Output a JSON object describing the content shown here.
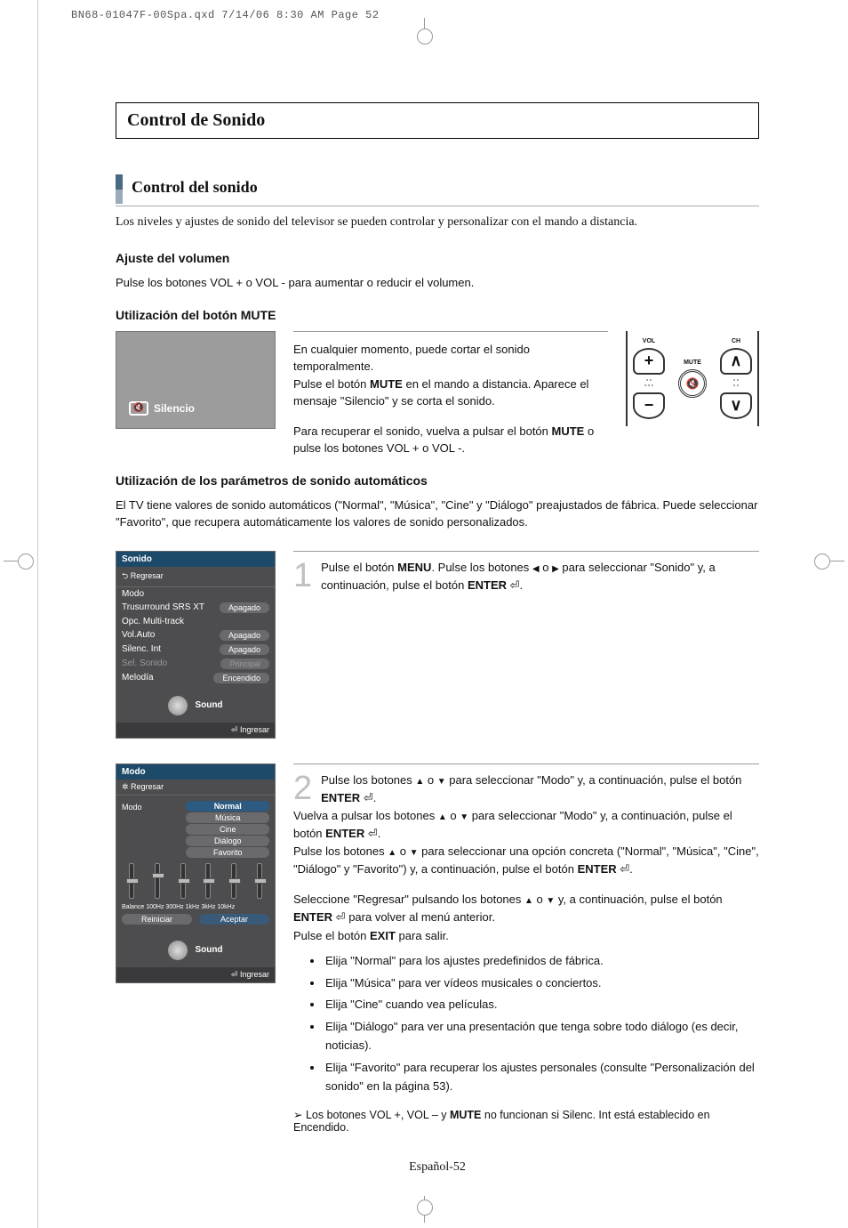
{
  "print_header": "BN68-01047F-00Spa.qxd  7/14/06  8:30 AM  Page 52",
  "title": "Control de Sonido",
  "section": {
    "heading": "Control del sonido",
    "intro": "Los niveles y ajustes de sonido del televisor se pueden controlar y personalizar con el mando a distancia."
  },
  "subs": {
    "vol": {
      "title": "Ajuste del volumen",
      "text": "Pulse los botones VOL + o VOL - para aumentar o reducir el volumen."
    },
    "mute": {
      "title": "Utilización del botón MUTE",
      "badge": "Silencio",
      "p1a": "En cualquier momento, puede cortar el sonido temporalmente.",
      "p1b_pre": "Pulse el botón ",
      "p1b_b": "MUTE",
      "p1b_post": " en el mando a distancia. Aparece el mensaje \"Silencio\" y se corta el sonido.",
      "p2_pre": "Para recuperar el sonido, vuelva a pulsar el botón ",
      "p2_b": "MUTE",
      "p2_post": " o pulse los botones VOL + o VOL -."
    },
    "auto": {
      "title": "Utilización de los parámetros de sonido automáticos",
      "intro": "El TV tiene valores de sonido automáticos (\"Normal\", \"Música\", \"Cine\" y \"Diálogo\" preajustados de fábrica. Puede seleccionar \"Favorito\", que recupera automáticamente los valores de sonido personalizados."
    }
  },
  "remote": {
    "vol": "VOL",
    "ch": "CH",
    "mute": "MUTE"
  },
  "osd1": {
    "title": "Sonido",
    "back": "Regresar",
    "items": [
      {
        "label": "Modo",
        "value": ""
      },
      {
        "label": "Trusurround SRS XT",
        "value": "Apagado"
      },
      {
        "label": "Opc. Multi-track",
        "value": ""
      },
      {
        "label": "Vol.Auto",
        "value": "Apagado"
      },
      {
        "label": "Silenc. Int",
        "value": "Apagado"
      },
      {
        "label": "Sel. Sonido",
        "value": "Principal",
        "disabled": true
      },
      {
        "label": "Melodía",
        "value": "Encendido"
      }
    ],
    "cat": "Sound",
    "enter": "Ingresar"
  },
  "osd2": {
    "title": "Modo",
    "back": "Regresar",
    "left": "Modo",
    "opts": [
      "Normal",
      "Música",
      "Cine",
      "Diálogo",
      "Favorito"
    ],
    "eq": "Balance 100Hz 300Hz 1kHz  3kHz 10kHz",
    "reset": "Reiniciar",
    "accept": "Aceptar",
    "cat": "Sound",
    "enter": "Ingresar"
  },
  "step1": {
    "num": "1",
    "t1": "Pulse el botón ",
    "b1": "MENU",
    "t2": ". Pulse los botones ",
    "t3": " o ",
    "t4": " para seleccionar \"Sonido\" y, a continuación, pulse el botón ",
    "b2": "ENTER",
    "t5": "."
  },
  "step2": {
    "num": "2",
    "l1a": "Pulse los botones ",
    "l1b": " o ",
    "l1c": " para seleccionar \"Modo\" y, a continuación, pulse el botón ",
    "enter": "ENTER",
    "dot": ".",
    "l2a": "Vuelva a pulsar los botones ",
    "l2b": " o ",
    "l2c": " para seleccionar \"Modo\"  y, a continuación, pulse el botón ",
    "l3a": "Pulse los botones ",
    "l3b": " o ",
    "l3c": " para seleccionar una opción concreta (\"Normal\", \"Música\", \"Cine\", \"Diálogo\" y \"Favorito\") y, a continuación, pulse el botón ",
    "l4a": "Seleccione \"Regresar\" pulsando los botones ",
    "l4b": " o ",
    "l4c": " y, a continuación, pulse el botón ",
    "l4d": " para volver al menú anterior.",
    "l5a": "Pulse el botón ",
    "exit": "EXIT",
    "l5b": " para salir.",
    "opts": [
      "Elija \"Normal\" para los ajustes predefinidos de fábrica.",
      "Elija \"Música\" para ver vídeos musicales o conciertos.",
      "Elija \"Cine\" cuando vea películas.",
      "Elija \"Diálogo\" para ver una presentación que tenga sobre todo diálogo (es decir, noticias).",
      "Elija \"Favorito\" para recuperar los ajustes personales (consulte \"Personalización del sonido\" en la página 53)."
    ]
  },
  "note_a": "Los botones VOL +, VOL – y ",
  "note_b": "MUTE",
  "note_c": " no funcionan si Silenc. Int está establecido en Encendido.",
  "footer": "Español-52"
}
